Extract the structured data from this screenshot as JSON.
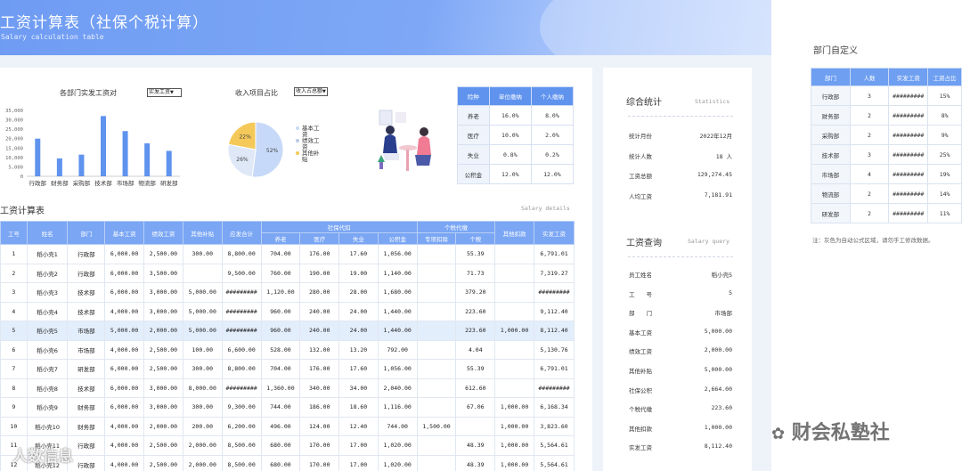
{
  "header": {
    "title": "工资计算表（社保个税计算）",
    "subtitle": "Salary calculation table"
  },
  "bar_chart": {
    "title": "各部门实发工资对",
    "selector": "实发工资",
    "chart_data": {
      "type": "bar",
      "categories": [
        "行政部",
        "财务部",
        "采购部",
        "技术部",
        "市场部",
        "物流部",
        "研发部"
      ],
      "values": [
        20000,
        9500,
        11500,
        32000,
        24000,
        17500,
        13500
      ],
      "ylim": [
        0,
        35000
      ],
      "yticks": [
        "35,000",
        "30,000",
        "25,000",
        "20,000",
        "15,000",
        "10,000",
        "5,000",
        "0"
      ],
      "color": "#5f93ee"
    }
  },
  "pie_chart": {
    "title": "收入项目占比",
    "selector": "收入占总额",
    "chart_data": {
      "type": "pie",
      "labels": [
        "基本工资",
        "绩效工资",
        "其他补贴"
      ],
      "values": [
        52,
        26,
        22
      ],
      "value_labels": [
        "52%",
        "26%",
        "22%"
      ],
      "colors": [
        "#c7d9f8",
        "#dfe8f7",
        "#f5c85a"
      ]
    }
  },
  "insurance": {
    "headers": [
      "险种",
      "单位缴纳",
      "个人缴纳"
    ],
    "rows": [
      [
        "养老",
        "16.0%",
        "8.0%"
      ],
      [
        "医疗",
        "10.0%",
        "2.0%"
      ],
      [
        "失业",
        "0.8%",
        "0.2%"
      ],
      [
        "公积金",
        "12.0%",
        "12.0%"
      ]
    ]
  },
  "salary": {
    "title": "工资计算表",
    "title_en": "Salary details",
    "headers_top": [
      "工号",
      "姓名",
      "部门",
      "基本工资",
      "绩效工资",
      "其他补贴",
      "应发合计",
      "社保代扣",
      "个税代缴",
      "其他扣款",
      "实发工资"
    ],
    "headers_sub": [
      "养老",
      "医疗",
      "失业",
      "公积金",
      "专项扣除",
      "个税"
    ],
    "rows": [
      [
        "1",
        "稻小壳1",
        "行政部",
        "6,000.00",
        "2,500.00",
        "300.00",
        "8,800.00",
        "704.00",
        "176.00",
        "17.60",
        "1,056.00",
        "",
        "55.39",
        "",
        "6,791.01"
      ],
      [
        "2",
        "稻小壳2",
        "行政部",
        "6,000.00",
        "3,500.00",
        "",
        "9,500.00",
        "760.00",
        "190.00",
        "19.00",
        "1,140.00",
        "",
        "71.73",
        "",
        "7,319.27"
      ],
      [
        "3",
        "稻小壳3",
        "技术部",
        "6,000.00",
        "3,000.00",
        "5,000.00",
        "#########",
        "1,120.00",
        "280.00",
        "28.00",
        "1,680.00",
        "",
        "379.20",
        "",
        "#########"
      ],
      [
        "4",
        "稻小壳4",
        "技术部",
        "4,000.00",
        "3,000.00",
        "5,000.00",
        "#########",
        "960.00",
        "240.00",
        "24.00",
        "1,440.00",
        "",
        "223.60",
        "",
        "9,112.40"
      ],
      [
        "5",
        "稻小壳5",
        "市场部",
        "5,000.00",
        "2,000.00",
        "5,000.00",
        "#########",
        "960.00",
        "240.00",
        "24.00",
        "1,440.00",
        "",
        "223.60",
        "1,000.00",
        "8,112.40"
      ],
      [
        "6",
        "稻小壳6",
        "市场部",
        "4,000.00",
        "2,500.00",
        "100.00",
        "6,600.00",
        "528.00",
        "132.00",
        "13.20",
        "792.00",
        "",
        "4.04",
        "",
        "5,130.76"
      ],
      [
        "7",
        "稻小壳7",
        "研发部",
        "6,000.00",
        "2,500.00",
        "300.00",
        "8,800.00",
        "704.00",
        "176.00",
        "17.60",
        "1,056.00",
        "",
        "55.39",
        "",
        "6,791.01"
      ],
      [
        "8",
        "稻小壳8",
        "技术部",
        "6,000.00",
        "3,000.00",
        "8,000.00",
        "#########",
        "1,360.00",
        "340.00",
        "34.00",
        "2,040.00",
        "",
        "612.60",
        "",
        "#########"
      ],
      [
        "9",
        "稻小壳9",
        "财务部",
        "6,000.00",
        "3,000.00",
        "300.00",
        "9,300.00",
        "744.00",
        "186.00",
        "18.60",
        "1,116.00",
        "",
        "67.06",
        "1,000.00",
        "6,168.34"
      ],
      [
        "10",
        "稻小壳10",
        "财务部",
        "4,000.00",
        "2,000.00",
        "200.00",
        "6,200.00",
        "496.00",
        "124.00",
        "12.40",
        "744.00",
        "1,500.00",
        "",
        "1,000.00",
        "3,823.60"
      ],
      [
        "11",
        "稻小壳11",
        "行政部",
        "4,000.00",
        "2,500.00",
        "2,000.00",
        "8,500.00",
        "680.00",
        "170.00",
        "17.00",
        "1,020.00",
        "",
        "48.39",
        "1,000.00",
        "5,564.61"
      ],
      [
        "12",
        "稻小壳12",
        "行政部",
        "4,000.00",
        "2,500.00",
        "2,000.00",
        "8,500.00",
        "680.00",
        "170.00",
        "17.00",
        "1,020.00",
        "",
        "48.39",
        "1,000.00",
        "5,564.61"
      ]
    ]
  },
  "stats": {
    "title": "综合统计",
    "title_en": "Statistics",
    "rows": [
      {
        "k": "统计月份",
        "v": "2022年12月"
      },
      {
        "k": "统计人数",
        "v": "18 人"
      },
      {
        "k": "工资总额",
        "v": "129,274.45"
      },
      {
        "k": "人均工资",
        "v": "7,181.91"
      }
    ]
  },
  "query": {
    "title": "工资查询",
    "title_en": "Salary query",
    "rows": [
      {
        "k": "员工姓名",
        "v": "稻小壳5"
      },
      {
        "k": "工　　号",
        "v": "5"
      },
      {
        "k": "部　　门",
        "v": "市场部"
      },
      {
        "k": "基本工资",
        "v": "5,000.00"
      },
      {
        "k": "绩效工资",
        "v": "2,000.00"
      },
      {
        "k": "其他补贴",
        "v": "5,000.00"
      },
      {
        "k": "社保公积",
        "v": "2,664.00"
      },
      {
        "k": "个税代缴",
        "v": "223.60"
      },
      {
        "k": "其他扣款",
        "v": "1,000.00"
      },
      {
        "k": "实发工资",
        "v": "8,112.40"
      }
    ]
  },
  "dept": {
    "title": "部门自定义",
    "headers": [
      "部门",
      "人数",
      "实发工资",
      "工资占比"
    ],
    "rows": [
      [
        "行政部",
        "3",
        "#########",
        "15%"
      ],
      [
        "财务部",
        "2",
        "#########",
        "8%"
      ],
      [
        "采购部",
        "2",
        "#########",
        "9%"
      ],
      [
        "技术部",
        "3",
        "#########",
        "25%"
      ],
      [
        "市场部",
        "4",
        "#########",
        "19%"
      ],
      [
        "物流部",
        "2",
        "#########",
        "14%"
      ],
      [
        "研发部",
        "2",
        "#########",
        "11%"
      ]
    ],
    "note": "注：灰色为自动公式区域，请勿手工修改数据。"
  },
  "watermarks": {
    "right": "财会私塾社",
    "left": "人数信息"
  }
}
